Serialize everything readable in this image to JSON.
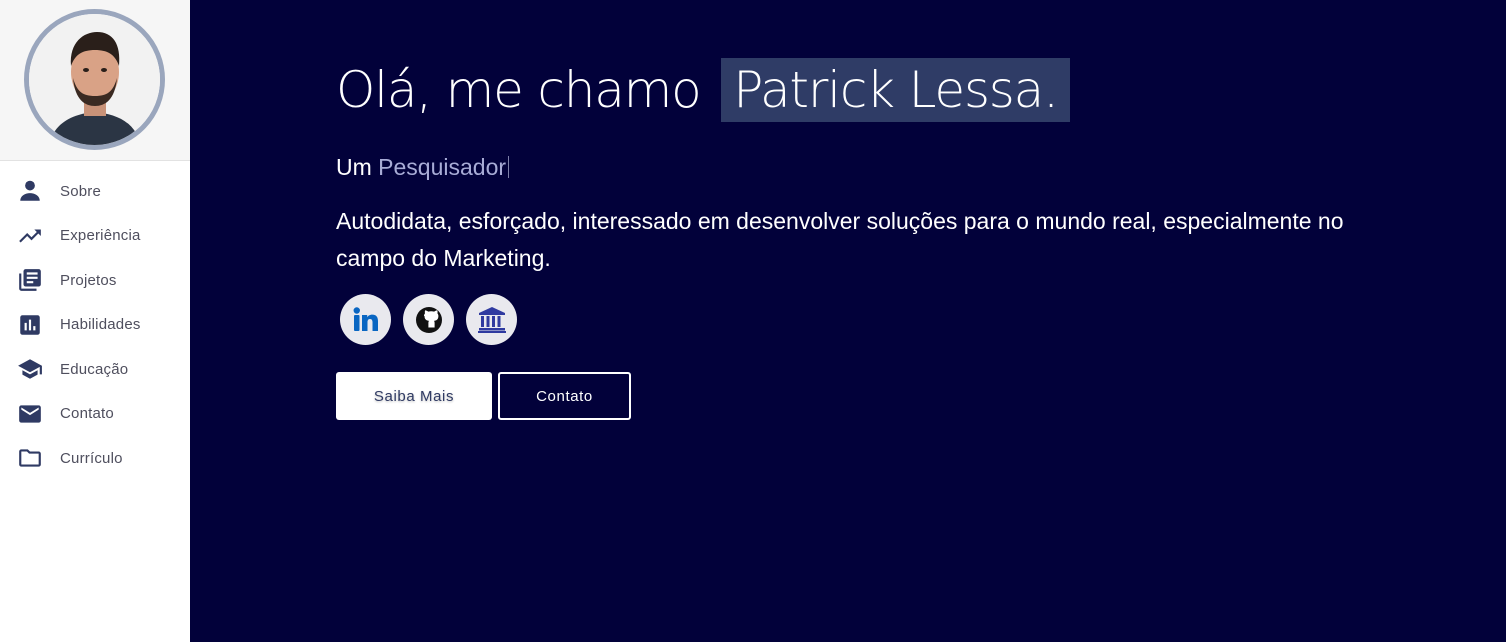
{
  "sidebar": {
    "items": [
      {
        "label": "Sobre",
        "icon": "person-icon"
      },
      {
        "label": "Experiência",
        "icon": "trending-up-icon"
      },
      {
        "label": "Projetos",
        "icon": "library-books-icon"
      },
      {
        "label": "Habilidades",
        "icon": "bar-chart-icon"
      },
      {
        "label": "Educação",
        "icon": "graduation-cap-icon"
      },
      {
        "label": "Contato",
        "icon": "mail-icon"
      },
      {
        "label": "Currículo",
        "icon": "folder-icon"
      }
    ]
  },
  "hero": {
    "greeting": "Olá, me chamo",
    "name": "Patrick Lessa.",
    "subtitle_prefix": "Um",
    "role": "Pesquisador",
    "description": "Autodidata, esforçado, interessado em desenvolver soluções para o mundo real, especialmente no campo do Marketing."
  },
  "social": [
    {
      "icon": "linkedin-icon"
    },
    {
      "icon": "github-icon"
    },
    {
      "icon": "institution-icon"
    }
  ],
  "buttons": {
    "primary": "Saiba Mais",
    "secondary": "Contato"
  },
  "colors": {
    "background": "#02013a",
    "accent": "#2f3a63",
    "highlight": "#2f3c66",
    "role_text": "#a8acd6"
  }
}
